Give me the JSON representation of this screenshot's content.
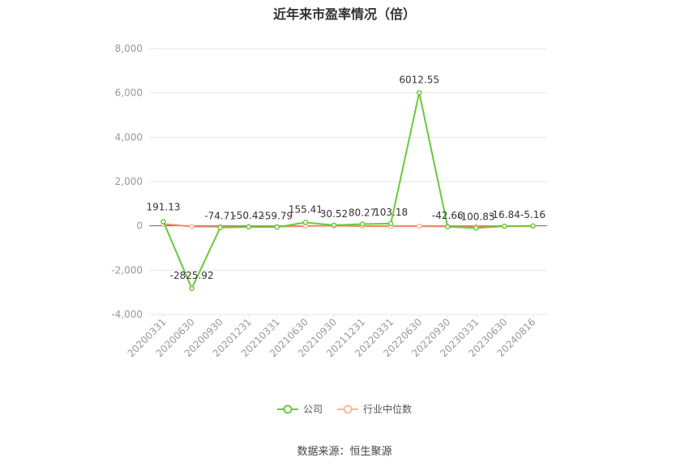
{
  "chart_data": {
    "type": "line",
    "title": "近年来市盈率情况（倍）",
    "categories": [
      "20200331",
      "20200630",
      "20200930",
      "20201231",
      "20210331",
      "20210630",
      "20210930",
      "20211231",
      "20220331",
      "20220630",
      "20220930",
      "20230331",
      "20230630",
      "20240816"
    ],
    "series": [
      {
        "name": "公司",
        "color": "#6CC93A",
        "values": [
          191.13,
          -2825.92,
          -74.71,
          -50.42,
          -59.79,
          155.41,
          30.52,
          80.27,
          103.18,
          6012.55,
          -42.66,
          -100.83,
          -16.84,
          -5.16
        ],
        "labels": [
          "191.13",
          "-2825.92",
          "-74.71",
          "-50.42",
          "-59.79",
          "155.41",
          "30.52",
          "80.27",
          "103.18",
          "6012.55",
          "-42.66",
          "-100.83",
          "-16.84",
          "-5.16"
        ]
      },
      {
        "name": "行业中位数",
        "color": "#F08A5D",
        "values": [
          80,
          -30,
          -40,
          -35,
          -30,
          -10,
          5,
          -10,
          -15,
          -15,
          -25,
          -30,
          -20,
          -15
        ]
      }
    ],
    "yticks": [
      "8,000",
      "6,000",
      "4,000",
      "2,000",
      "0",
      "-2,000",
      "-4,000"
    ],
    "ylim": [
      -4000,
      8000
    ],
    "grid": true,
    "legend_position": "bottom"
  },
  "source_text": "数据来源：恒生聚源"
}
